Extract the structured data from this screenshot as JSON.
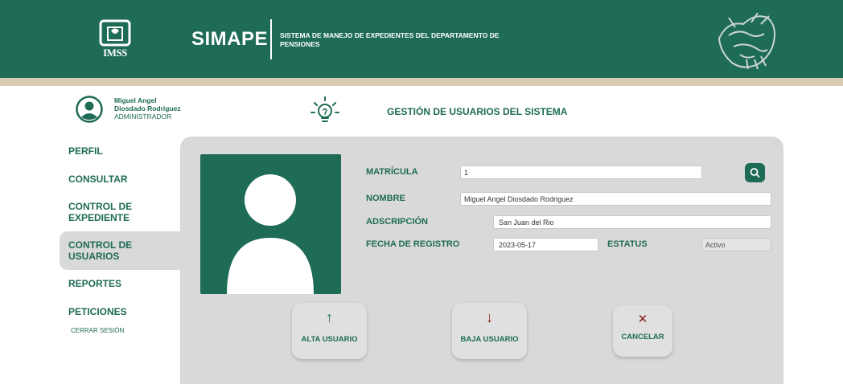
{
  "header": {
    "logo_text": "IMSS",
    "app_name": "SIMAPE",
    "app_desc": "SISTEMA DE MANEJO DE EXPEDIENTES DEL DEPARTAMENTO DE PENSIONES"
  },
  "user": {
    "name_line1": "Miguel Angel",
    "name_line2": "Diosdado Rodriguez",
    "role": "ADMINISTRADOR"
  },
  "page": {
    "title": "GESTIÓN DE USUARIOS DEL SISTEMA"
  },
  "sidebar": {
    "items": [
      {
        "label_lines": [
          "PERFIL"
        ]
      },
      {
        "label_lines": [
          "CONSULTAR"
        ]
      },
      {
        "label_lines": [
          "CONTROL DE",
          "EXPEDIENTE"
        ]
      },
      {
        "label_lines": [
          "CONTROL DE",
          "USUARIOS"
        ],
        "active": true
      },
      {
        "label_lines": [
          "REPORTES"
        ]
      },
      {
        "label_lines": [
          "PETICIONES"
        ]
      }
    ],
    "logout": "CERRAR SESIÓN"
  },
  "form": {
    "matricula": {
      "label": "MATRÍCULA",
      "value": "1"
    },
    "nombre": {
      "label": "NOMBRE",
      "value": "Miguel Angel Diosdado Rodriguez"
    },
    "adscripcion": {
      "label": "ADSCRIPCIÓN",
      "value": "San Juan del Rio"
    },
    "fecha": {
      "label": "FECHA DE REGISTRO",
      "value": "2023-05-17"
    },
    "estatus": {
      "label": "ESTATUS",
      "value": "Activo"
    }
  },
  "actions": {
    "alta": {
      "label": "ALTA USUARIO",
      "glyph": "↑"
    },
    "baja": {
      "label": "BAJA USUARIO",
      "glyph": "↓"
    },
    "cancelar": {
      "label": "CANCELAR",
      "glyph": "✕"
    }
  },
  "colors": {
    "primary": "#1e6b56",
    "accent": "#d8cdb1",
    "danger": "#8b1a1a"
  },
  "icons": [
    "imss-logo-icon",
    "national-emblem-icon",
    "user-avatar-icon",
    "lightbulb-icon",
    "search-icon",
    "arrow-up-icon",
    "arrow-down-icon",
    "close-icon"
  ]
}
